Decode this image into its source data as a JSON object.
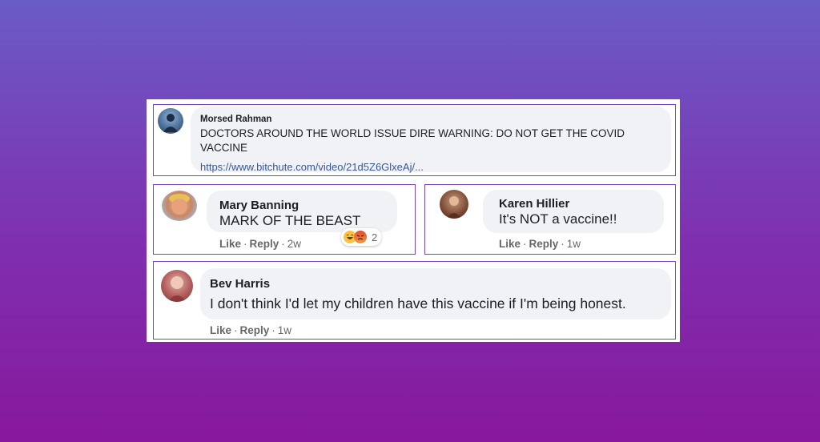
{
  "comments": [
    {
      "name": "Morsed Rahman",
      "text_line1": "DOCTORS AROUND THE WORLD ISSUE DIRE WARNING: DO NOT GET THE COVID",
      "text_line2": "VACCINE",
      "link": "https://www.bitchute.com/video/21d5Z6GlxeAj/..."
    },
    {
      "name": "Mary Banning",
      "text": "MARK OF THE BEAST",
      "like": "Like",
      "reply": "Reply",
      "time": "2w",
      "reaction_count": "2",
      "reaction_icons": [
        "haha-icon",
        "angry-icon"
      ]
    },
    {
      "name": "Karen Hillier",
      "text": "It's NOT a vaccine!!",
      "like": "Like",
      "reply": "Reply",
      "time": "1w"
    },
    {
      "name": "Bev Harris",
      "text": "I don't think I'd let my children have this vaccine if I'm being honest.",
      "like": "Like",
      "reply": "Reply",
      "time": "1w"
    }
  ],
  "colors": {
    "border": "#7d45b8",
    "bubble": "#f0f2f5",
    "link": "#385898",
    "meta": "#65676b"
  }
}
